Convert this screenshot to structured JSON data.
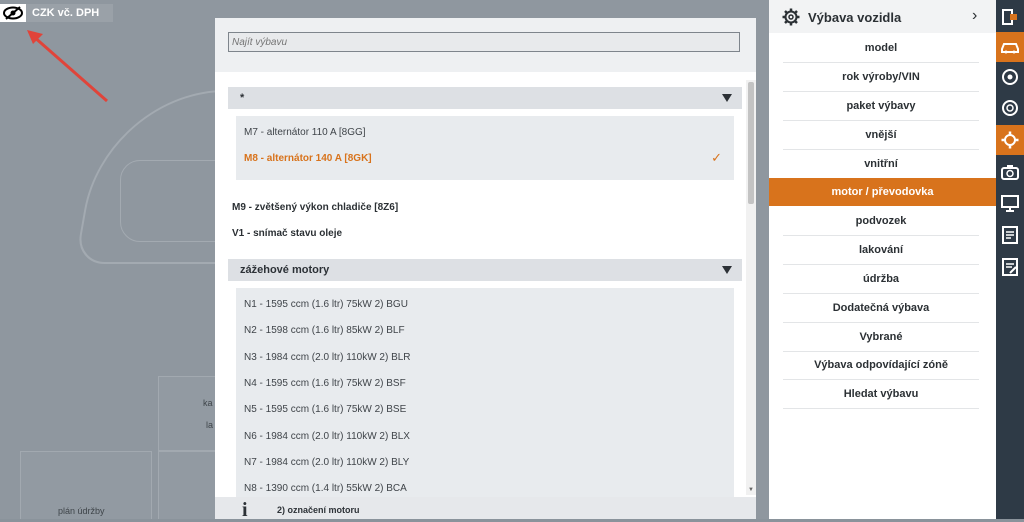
{
  "header": {
    "price_label": "CZK vč. DPH"
  },
  "search": {
    "placeholder": "Najít výbavu"
  },
  "groups": [
    {
      "title": "*",
      "options": [
        "M7 - alternátor 110 A [8GG]",
        "M8 - alternátor 140 A [8GK]"
      ],
      "selected": "M8 - alternátor 140 A [8GK]",
      "check": "✓"
    },
    {
      "title": "zážehové motory",
      "options": [
        "N1 - 1595 ccm (1.6 ltr) 75kW 2) BGU",
        "N2 - 1598 ccm (1.6 ltr) 85kW 2) BLF",
        "N3 - 1984 ccm (2.0 ltr) 110kW 2) BLR",
        "N4 - 1595 ccm (1.6 ltr) 75kW 2) BSF",
        "N5 - 1595 ccm (1.6 ltr) 75kW 2) BSE",
        "N6 - 1984 ccm (2.0 ltr) 110kW 2) BLX",
        "N7 - 1984 ccm (2.0 ltr) 110kW 2) BLY",
        "N8 - 1390 ccm (1.4 ltr) 55kW 2) BCA"
      ]
    }
  ],
  "standalone": [
    "M9 - zvětšený výkon chladiče [8Z6]",
    "V1 - snímač stavu oleje"
  ],
  "footer": {
    "icon": "i",
    "text": "2) označení motoru"
  },
  "panel": {
    "title": "Výbava vozidla",
    "items": [
      "model",
      "rok výroby/VIN",
      "paket výbavy",
      "vnější",
      "vnitřní",
      "motor / převodovka",
      "podvozek",
      "lakování",
      "údržba",
      "Dodatečná výbava",
      "Vybrané",
      "Výbava odpovídající zóně",
      "Hledat výbavu"
    ],
    "active": "motor / převodovka"
  },
  "background": {
    "tile_labels": [
      "ka",
      "la",
      "plán údržby"
    ]
  },
  "colors": {
    "accent": "#d8731c",
    "rail": "#2e3a46"
  },
  "rail_icons": [
    "exit-icon",
    "car-icon",
    "wheel-icon",
    "search-icon",
    "gear-icon",
    "camera-icon",
    "monitor-icon",
    "list-icon",
    "notes-icon"
  ]
}
